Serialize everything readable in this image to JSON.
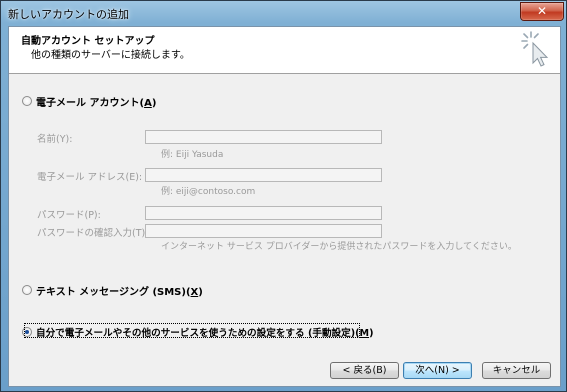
{
  "window": {
    "title": "新しいアカウントの追加",
    "close_glyph": "✕"
  },
  "header": {
    "title": "自動アカウント セットアップ",
    "subtitle": "他の種類のサーバーに接続します。"
  },
  "options": {
    "email_account": {
      "label": "電子メール アカウント(",
      "key": "A",
      "suffix": ")",
      "selected": false
    },
    "sms": {
      "label": "テキスト メッセージング (SMS)(",
      "key": "X",
      "suffix": ")",
      "selected": false
    },
    "manual": {
      "label": "自分で電子メールやその他のサービスを使うための設定をする (手動設定)(",
      "key": "M",
      "suffix": ")",
      "selected": true
    }
  },
  "fields": {
    "name": {
      "label": "名前(Y):",
      "value": "",
      "hint": "例: Eiji Yasuda"
    },
    "email": {
      "label": "電子メール アドレス(E):",
      "value": "",
      "hint": "例: eiji@contoso.com"
    },
    "password": {
      "label": "パスワード(P):",
      "value": ""
    },
    "password_confirm": {
      "label": "パスワードの確認入力(T):",
      "value": ""
    },
    "password_hint": "インターネット サービス プロバイダーから提供されたパスワードを入力してください。"
  },
  "buttons": {
    "back": "< 戻る(B)",
    "next": "次へ(N) >",
    "cancel": "キャンセル"
  },
  "colors": {
    "title_bar": "#7fb0d4",
    "close_button": "#c13a21",
    "radio_dot": "#1e4f9a",
    "default_button_border": "#3c7fb1"
  }
}
